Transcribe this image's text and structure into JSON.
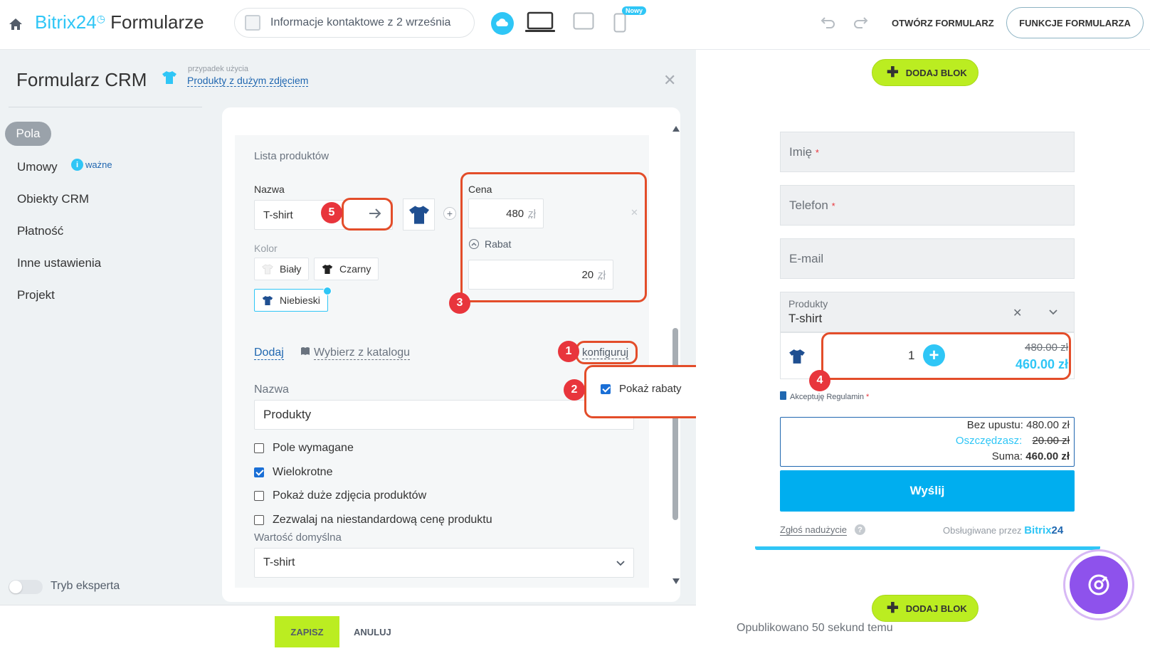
{
  "topbar": {
    "brand_b24": "Bitrix24",
    "brand_name": "Formularze",
    "form_chip": "Informacje kontaktowe z 2 września",
    "new_badge": "Nowy",
    "open_form": "OTWÓRZ FORMULARZ",
    "form_functions": "FUNKCJE FORMULARZA"
  },
  "panel": {
    "title": "Formularz CRM",
    "usecase_label": "przypadek użycia",
    "usecase_link": "Produkty z dużym zdjęciem",
    "nav": [
      "Pola",
      "Umowy",
      "Obiekty CRM",
      "Płatność",
      "Inne ustawienia",
      "Projekt"
    ],
    "wazne": "ważne",
    "expert_mode": "Tryb eksperta"
  },
  "editor": {
    "section_title": "Lista produktów",
    "name_label": "Nazwa",
    "name_value": "T-shirt",
    "color_label": "Kolor",
    "colors": [
      "Biały",
      "Czarny",
      "Niebieski"
    ],
    "price_label": "Cena",
    "price_value": "480",
    "currency": "zł",
    "discount_label": "Rabat",
    "discount_value": "20",
    "add_link": "Dodaj",
    "catalog_link": "Wybierz z katalogu",
    "configure_link": "konfiguruj",
    "show_discounts": "Pokaż rabaty",
    "field_name_label": "Nazwa",
    "field_name_value": "Produkty",
    "checkboxes": [
      {
        "label": "Pole wymagane",
        "checked": false
      },
      {
        "label": "Wielokrotne",
        "checked": true
      },
      {
        "label": "Pokaż duże zdjęcia produktów",
        "checked": false
      },
      {
        "label": "Zezwalaj na niestandardową cenę produktu",
        "checked": false
      }
    ],
    "default_label": "Wartość domyślna",
    "default_value": "T-shirt"
  },
  "badges": [
    "1",
    "2",
    "3",
    "4",
    "5"
  ],
  "bottombar": {
    "save": "ZAPISZ",
    "cancel": "ANULUJ"
  },
  "preview": {
    "add_block": "DODAJ BLOK",
    "fields": [
      "Imię",
      "Telefon",
      "E-mail"
    ],
    "required_mark": "*",
    "products_label": "Produkty",
    "products_value": "T-shirt",
    "qty": "1",
    "old_price": "480.00 zł",
    "new_price": "460.00 zł",
    "accept_terms": "Akceptuję Regulamin",
    "summary": {
      "no_discount_label": "Bez upustu:",
      "no_discount_value": "480.00 zł",
      "save_label": "Oszczędzasz:",
      "save_value": "20.00 zł",
      "total_label": "Suma:",
      "total_value": "460.00 zł"
    },
    "submit": "Wyślij",
    "report_abuse": "Zgłoś nadużycie",
    "powered_by": "Obsługiwane przez",
    "powered_brand": "Bitrix",
    "powered_num": "24",
    "published": "Opublikowano 50 sekund temu"
  },
  "colors": {
    "accent": "#2fc6f6",
    "green": "#bbed21",
    "highlight": "#e34d2a",
    "link": "#2067b0"
  }
}
